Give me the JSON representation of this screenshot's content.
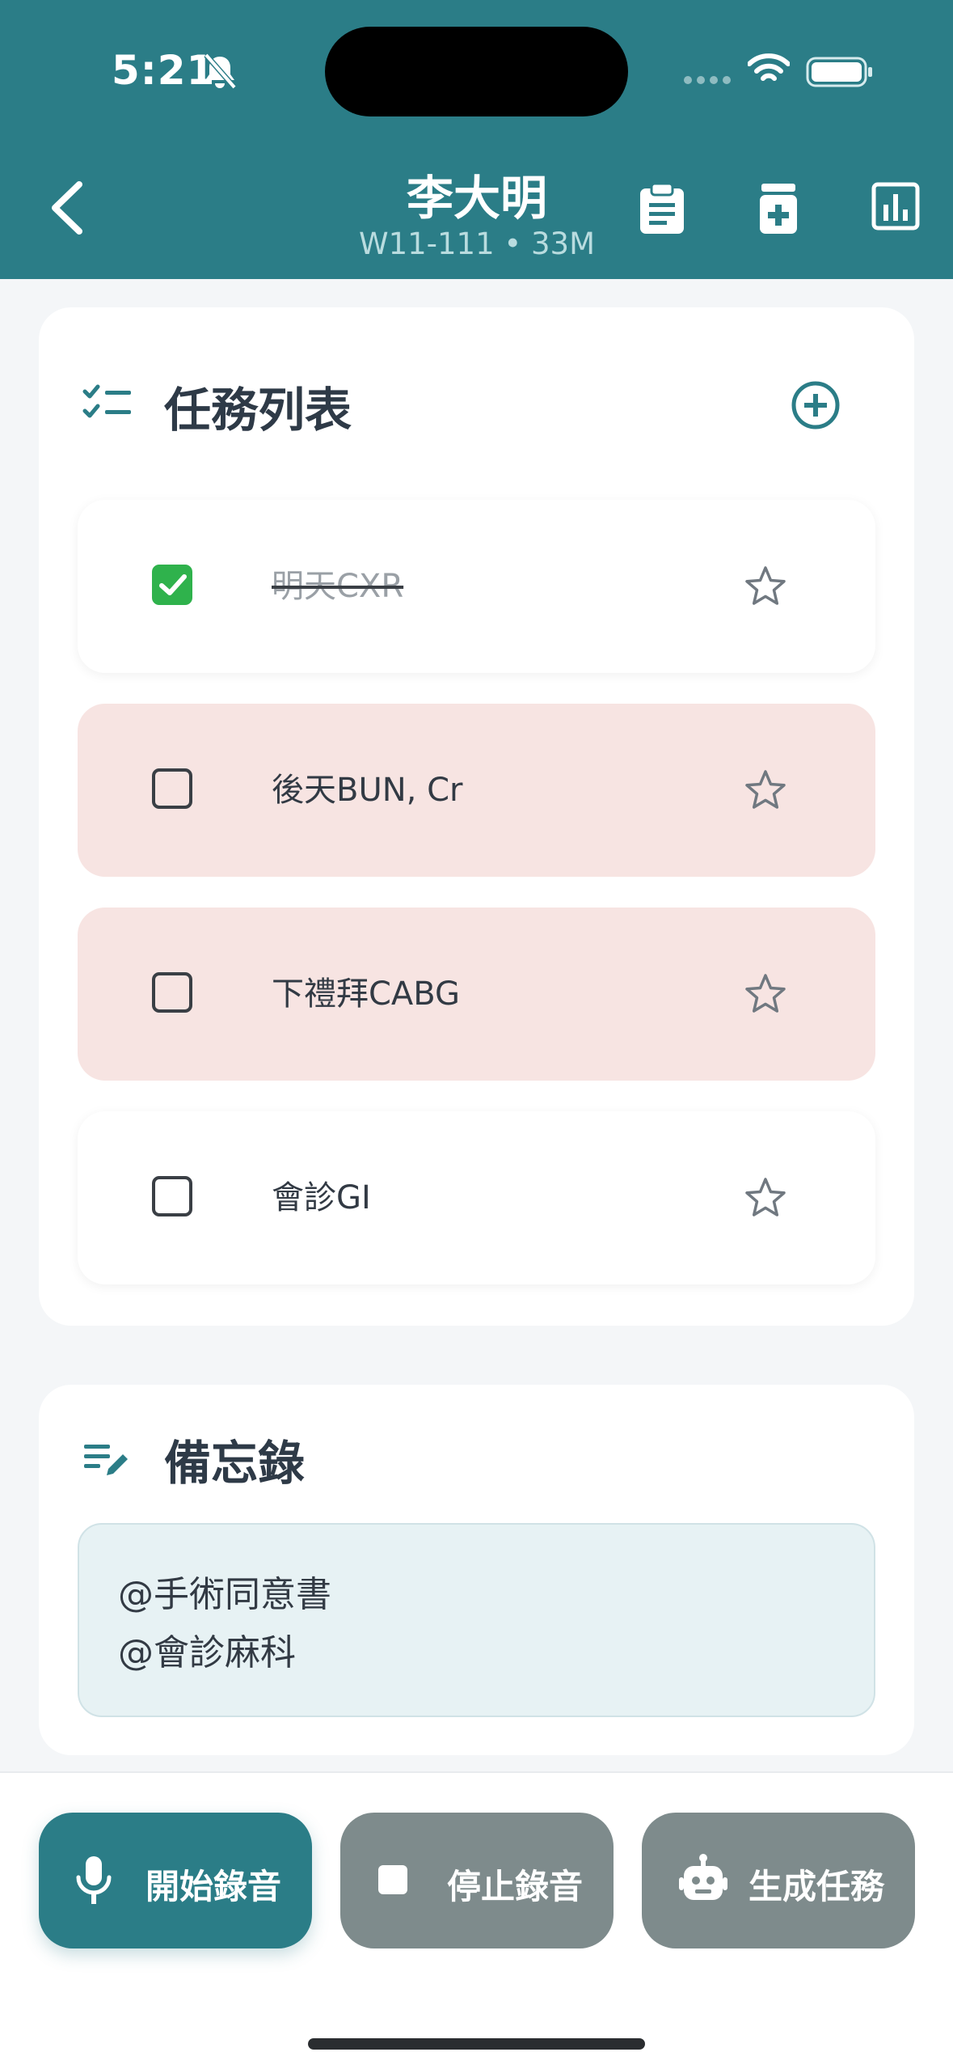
{
  "status_bar": {
    "time": "5:21"
  },
  "header": {
    "patient_name": "李大明",
    "patient_info": "W11-111 • 33M"
  },
  "tasks_card": {
    "title": "任務列表",
    "items": [
      {
        "label": "明天CXR",
        "done": true,
        "highlight": false
      },
      {
        "label": "後天BUN, Cr",
        "done": false,
        "highlight": true
      },
      {
        "label": "下禮拜CABG",
        "done": false,
        "highlight": true
      },
      {
        "label": "會診GI",
        "done": false,
        "highlight": false
      }
    ]
  },
  "memo_card": {
    "title": "備忘錄",
    "lines": [
      "@手術同意書",
      "@會診麻科"
    ]
  },
  "actions": {
    "start_recording": "開始錄音",
    "stop_recording": "停止錄音",
    "generate_tasks": "生成任務"
  },
  "colors": {
    "primary": "#2b7d87",
    "highlight": "#f7e4e2",
    "checked": "#2fb24c",
    "disabled_button": "#7e8b8c"
  }
}
